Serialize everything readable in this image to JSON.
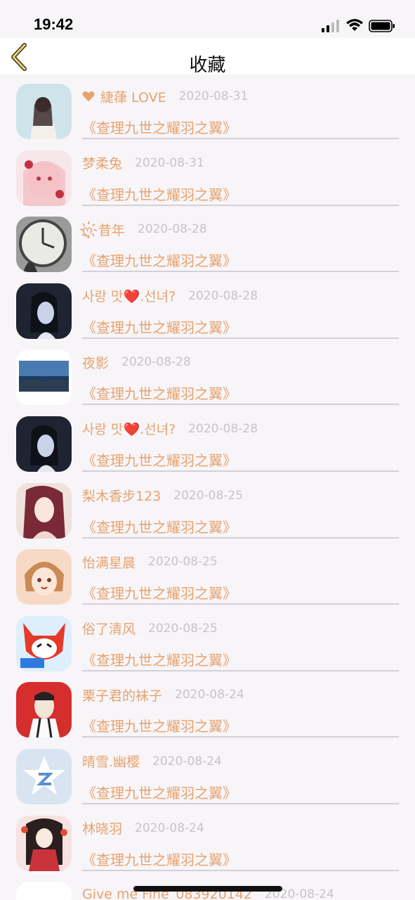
{
  "status": {
    "time": "19:42"
  },
  "nav": {
    "title": "收藏",
    "back_icon": "chevron-left-icon"
  },
  "colors": {
    "accent": "#e7a36f",
    "date": "#c7c4c7",
    "divider": "#d3d1d5",
    "background": "#f7f5f8"
  },
  "items": [
    {
      "name": "緁葎 LOVE",
      "date": "2020-08-31",
      "book": "《查理九世之耀羽之翼》",
      "heart": true,
      "avatar": "avatar-1"
    },
    {
      "name": "梦柔兔",
      "date": "2020-08-31",
      "book": "《查理九世之耀羽之翼》",
      "avatar": "avatar-2"
    },
    {
      "name": "ღ҉昔年",
      "date": "2020-08-28",
      "book": "《查理九世之耀羽之翼》",
      "avatar": "avatar-3"
    },
    {
      "name": "사랑 맛❤️.선녀?",
      "date": "2020-08-28",
      "book": "《查理九世之耀羽之翼》",
      "avatar": "avatar-4"
    },
    {
      "name": "夜影",
      "date": "2020-08-28",
      "book": "《查理九世之耀羽之翼》",
      "avatar": "avatar-5"
    },
    {
      "name": "사랑 맛❤️.선녀?",
      "date": "2020-08-28",
      "book": "《查理九世之耀羽之翼》",
      "avatar": "avatar-6"
    },
    {
      "name": "梨木香步123",
      "date": "2020-08-25",
      "book": "《查理九世之耀羽之翼》",
      "avatar": "avatar-7"
    },
    {
      "name": "怡满星晨",
      "date": "2020-08-25",
      "book": "《查理九世之耀羽之翼》",
      "avatar": "avatar-8"
    },
    {
      "name": "俗了清风",
      "date": "2020-08-25",
      "book": "《查理九世之耀羽之翼》",
      "avatar": "avatar-9"
    },
    {
      "name": "栗子君的袜子",
      "date": "2020-08-24",
      "book": "《查理九世之耀羽之翼》",
      "avatar": "avatar-10"
    },
    {
      "name": "晴雪.幽樱",
      "date": "2020-08-24",
      "book": "《查理九世之耀羽之翼》",
      "avatar": "avatar-11"
    },
    {
      "name": "林晓羽",
      "date": "2020-08-24",
      "book": "《查理九世之耀羽之翼》",
      "avatar": "avatar-12"
    },
    {
      "name": "Give me Fine_083920142",
      "date": "2020-08-24",
      "book": "",
      "avatar": "avatar-13"
    }
  ]
}
